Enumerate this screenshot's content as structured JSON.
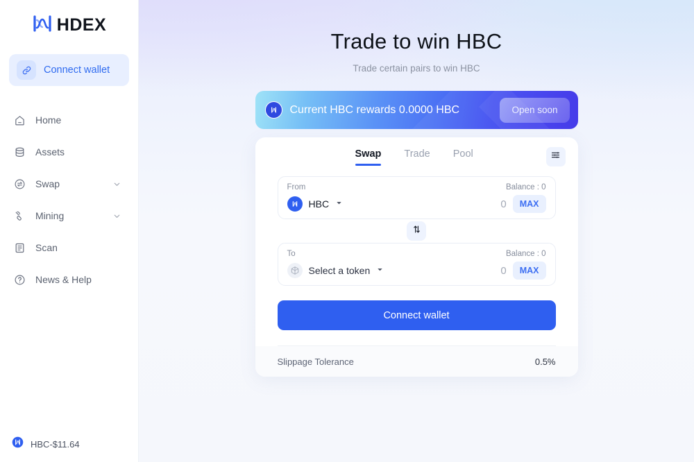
{
  "sidebar": {
    "logo": {
      "mark_icon": "hdex-logo-mark",
      "text": "HDEX"
    },
    "connect_wallet": {
      "label": "Connect wallet",
      "icon": "link-icon"
    },
    "items": [
      {
        "label": "Home",
        "icon": "home-icon",
        "has_chevron": false
      },
      {
        "label": "Assets",
        "icon": "assets-icon",
        "has_chevron": false
      },
      {
        "label": "Swap",
        "icon": "swap-icon",
        "has_chevron": true
      },
      {
        "label": "Mining",
        "icon": "mining-icon",
        "has_chevron": true
      },
      {
        "label": "Scan",
        "icon": "scan-icon",
        "has_chevron": false
      },
      {
        "label": "News & Help",
        "icon": "help-icon",
        "has_chevron": false
      }
    ],
    "footer": {
      "icon": "hbc-coin-icon",
      "label": "HBC-$11.64"
    }
  },
  "main": {
    "title": "Trade to win HBC",
    "subtitle": "Trade certain pairs to win HBC",
    "banner": {
      "coin_icon": "hbc-coin-icon",
      "text": "Current HBC rewards 0.0000 HBC",
      "button_label": "Open soon",
      "gradient_from": "#9fe3f7",
      "gradient_to": "#3b2fe8"
    },
    "card": {
      "tabs": [
        {
          "label": "Swap",
          "active": true
        },
        {
          "label": "Trade",
          "active": false
        },
        {
          "label": "Pool",
          "active": false
        }
      ],
      "settings_icon": "sliders-icon",
      "from": {
        "caption": "From",
        "balance": "Balance : 0",
        "token": "HBC",
        "token_icon": "hbc-coin-icon",
        "amount": "0",
        "amount_placeholder": "0",
        "max_label": "MAX",
        "chevron_icon": "chevron-down-icon"
      },
      "switch_icon": "swap-vertical-icon",
      "to": {
        "caption": "To",
        "balance": "Balance : 0",
        "token": "Select a token",
        "token_icon": "cube-placeholder-icon",
        "amount": "0",
        "amount_placeholder": "0",
        "max_label": "MAX",
        "chevron_icon": "chevron-down-icon"
      },
      "connect_button": "Connect wallet",
      "slippage": {
        "label": "Slippage Tolerance",
        "value": "0.5%"
      }
    }
  },
  "colors": {
    "accent_blue": "#2f5ff0",
    "light_blue_bg": "#e9f0fe",
    "muted_text": "#868d9c"
  }
}
